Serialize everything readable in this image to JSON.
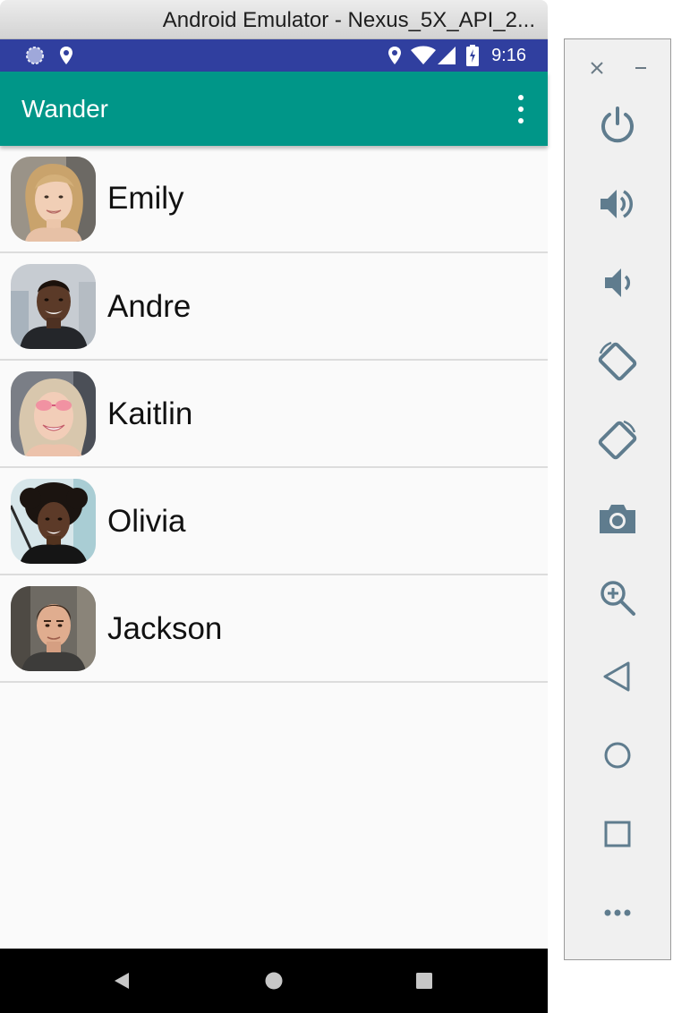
{
  "window": {
    "title": "Android Emulator - Nexus_5X_API_2..."
  },
  "status_bar": {
    "time": "9:16",
    "color": "#303f9f"
  },
  "app_bar": {
    "title": "Wander",
    "color": "#009688"
  },
  "contacts": [
    {
      "name": "Emily"
    },
    {
      "name": "Andre"
    },
    {
      "name": "Kaitlin"
    },
    {
      "name": "Olivia"
    },
    {
      "name": "Jackson"
    }
  ],
  "side_toolbar": {
    "icon_color": "#5f7c8e",
    "tools": [
      "power-icon",
      "volume-up-icon",
      "volume-down-icon",
      "rotate-left-icon",
      "rotate-right-icon",
      "camera-icon",
      "zoom-icon",
      "back-icon",
      "home-icon",
      "overview-icon",
      "more-icon"
    ]
  }
}
